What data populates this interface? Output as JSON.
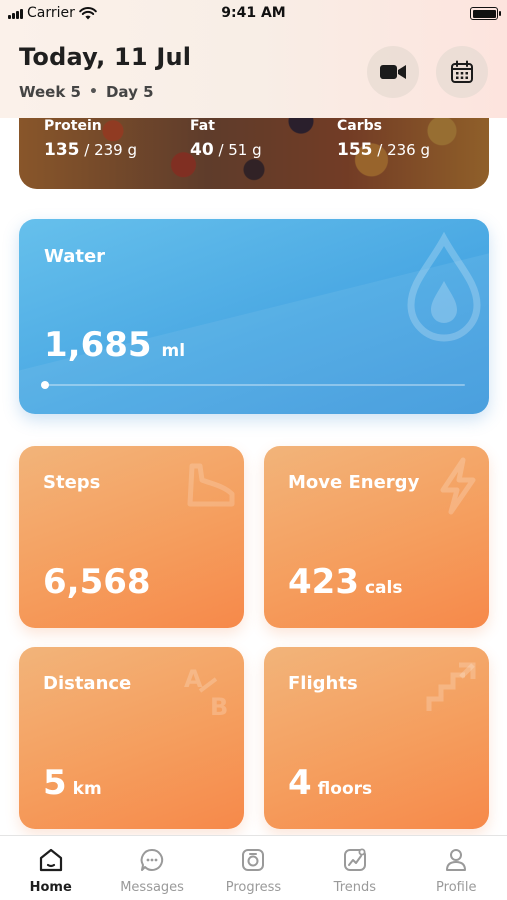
{
  "status_bar": {
    "carrier": "Carrier",
    "time": "9:41 AM"
  },
  "header": {
    "title": "Today, 11 Jul",
    "week": "Week 5",
    "separator": "•",
    "day": "Day 5",
    "video_button_icon": "video-camera-icon",
    "calendar_button_icon": "calendar-icon"
  },
  "macros": {
    "protein": {
      "label": "Protein",
      "value": "135",
      "target": " / 239 g"
    },
    "fat": {
      "label": "Fat",
      "value": "40",
      "target": " / 51 g"
    },
    "carbs": {
      "label": "Carbs",
      "value": "155",
      "target": " / 236 g"
    }
  },
  "water": {
    "label": "Water",
    "value": "1,685",
    "unit": "ml",
    "progress": 0.0,
    "icon": "water-drop-icon",
    "color": "#4aa8e3"
  },
  "tiles": {
    "steps": {
      "label": "Steps",
      "value": "6,568",
      "unit": "",
      "icon": "shoe-icon"
    },
    "move_energy": {
      "label": "Move Energy",
      "value": "423",
      "unit": "cals",
      "icon": "lightning-icon"
    },
    "distance": {
      "label": "Distance",
      "value": "5",
      "unit": "km",
      "icon": "a-to-b-icon"
    },
    "flights": {
      "label": "Flights",
      "value": "4",
      "unit": "floors",
      "icon": "stairs-icon"
    }
  },
  "tile_color": "#f59e5e",
  "tabbar": {
    "items": [
      {
        "label": "Home",
        "icon": "home-icon",
        "active": true
      },
      {
        "label": "Messages",
        "icon": "chat-bubble-icon",
        "active": false
      },
      {
        "label": "Progress",
        "icon": "progress-icon",
        "active": false
      },
      {
        "label": "Trends",
        "icon": "trend-chart-icon",
        "active": false
      },
      {
        "label": "Profile",
        "icon": "person-icon",
        "active": false
      }
    ]
  }
}
